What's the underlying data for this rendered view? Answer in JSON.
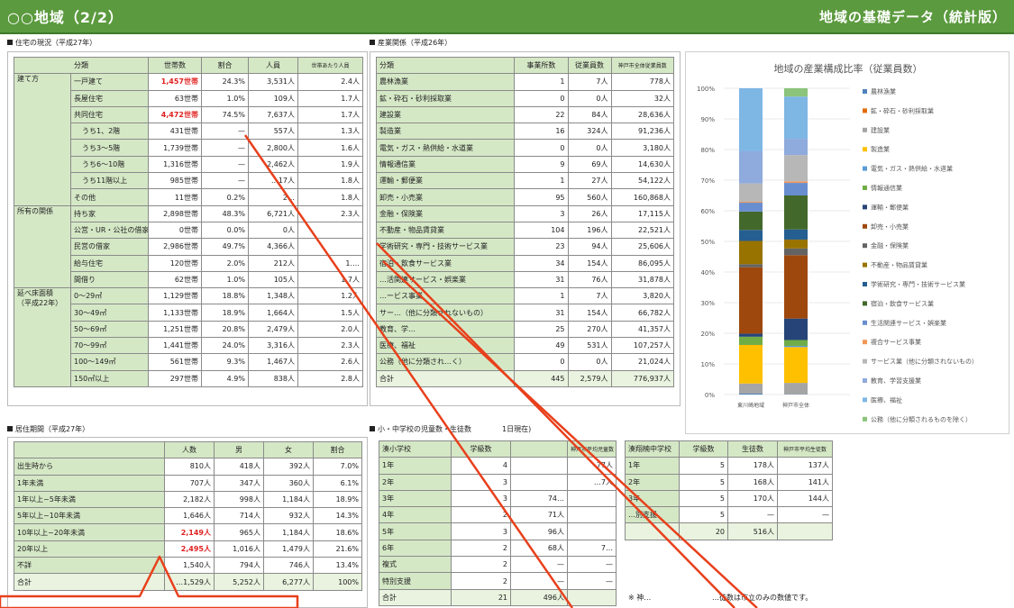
{
  "header": {
    "title": "○○地域（2/2）",
    "subtitle": "地域の基礎データ（統計版）"
  },
  "housing": {
    "label": "住宅の現況（平成27年）",
    "columns": [
      "分類",
      "世帯数",
      "割合",
      "人員",
      "世帯あたり人員"
    ],
    "groups": [
      {
        "category": "建て方",
        "rows": [
          {
            "sub": "一戸建て",
            "households": "1,457世帯",
            "ratio": "24.3%",
            "people": "3,531人",
            "per": "2.4人",
            "red": true
          },
          {
            "sub": "長屋住宅",
            "households": "63世帯",
            "ratio": "1.0%",
            "people": "109人",
            "per": "1.7人"
          },
          {
            "sub": "共同住宅",
            "households": "4,472世帯",
            "ratio": "74.5%",
            "people": "7,637人",
            "per": "1.7人",
            "red": true
          },
          {
            "sub": "うち1、2階",
            "households": "431世帯",
            "ratio": "—",
            "people": "557人",
            "per": "1.3人",
            "indent": true
          },
          {
            "sub": "うち3～5階",
            "households": "1,739世帯",
            "ratio": "—",
            "people": "2,800人",
            "per": "1.6人",
            "indent": true
          },
          {
            "sub": "うち6～10階",
            "households": "1,316世帯",
            "ratio": "—",
            "people": "2,462人",
            "per": "1.9人",
            "indent": true
          },
          {
            "sub": "うち11階以上",
            "households": "985世帯",
            "ratio": "—",
            "people": "…17人",
            "per": "1.8人",
            "indent": true
          },
          {
            "sub": "その他",
            "households": "11世帯",
            "ratio": "0.2%",
            "people": "2…",
            "per": "1.8人"
          }
        ]
      },
      {
        "category": "所有の関係",
        "rows": [
          {
            "sub": "持ち家",
            "households": "2,898世帯",
            "ratio": "48.3%",
            "people": "6,721人",
            "per": "2.3人"
          },
          {
            "sub": "公営・UR・公社の借家",
            "households": "0世帯",
            "ratio": "0.0%",
            "people": "0人",
            "per": ""
          },
          {
            "sub": "民営の借家",
            "households": "2,986世帯",
            "ratio": "49.7%",
            "people": "4,366人",
            "per": ""
          },
          {
            "sub": "給与住宅",
            "households": "120世帯",
            "ratio": "2.0%",
            "people": "212人",
            "per": "1.…"
          },
          {
            "sub": "間借り",
            "households": "62世帯",
            "ratio": "1.0%",
            "people": "105人",
            "per": "1.7人"
          }
        ]
      },
      {
        "category": "延べ床面積\n（平成22年）",
        "rows": [
          {
            "sub": "0～29㎡",
            "households": "1,129世帯",
            "ratio": "18.8%",
            "people": "1,348人",
            "per": "1.2人"
          },
          {
            "sub": "30～49㎡",
            "households": "1,133世帯",
            "ratio": "18.9%",
            "people": "1,664人",
            "per": "1.5人"
          },
          {
            "sub": "50～69㎡",
            "households": "1,251世帯",
            "ratio": "20.8%",
            "people": "2,479人",
            "per": "2.0人"
          },
          {
            "sub": "70～99㎡",
            "households": "1,441世帯",
            "ratio": "24.0%",
            "people": "3,316人",
            "per": "2.3人"
          },
          {
            "sub": "100～149㎡",
            "households": "561世帯",
            "ratio": "9.3%",
            "people": "1,467人",
            "per": "2.6人"
          },
          {
            "sub": "150㎡以上",
            "households": "297世帯",
            "ratio": "4.9%",
            "people": "838人",
            "per": "2.8人"
          }
        ]
      }
    ]
  },
  "industry": {
    "label": "産業関係（平成26年）",
    "columns": [
      "分類",
      "事業所数",
      "従業員数",
      "神戸市全体従業員数"
    ],
    "rows": [
      [
        "農林漁業",
        "1",
        "7人",
        "778人"
      ],
      [
        "鉱・砕石・砂利採取業",
        "0",
        "0人",
        "32人"
      ],
      [
        "建設業",
        "22",
        "84人",
        "28,636人"
      ],
      [
        "製造業",
        "16",
        "324人",
        "91,236人"
      ],
      [
        "電気・ガス・熱供給・水道業",
        "0",
        "0人",
        "3,180人"
      ],
      [
        "情報通信業",
        "9",
        "69人",
        "14,630人"
      ],
      [
        "運輸・郵便業",
        "1",
        "27人",
        "54,122人"
      ],
      [
        "卸売・小売業",
        "95",
        "560人",
        "160,868人"
      ],
      [
        "金融・保険業",
        "3",
        "26人",
        "17,115人"
      ],
      [
        "不動産・物品賃貸業",
        "104",
        "196人",
        "22,521人"
      ],
      [
        "学術研究・専門・技術サービス業",
        "23",
        "94人",
        "25,606人"
      ],
      [
        "宿泊・飲食サービス業",
        "34",
        "154人",
        "86,095人"
      ],
      [
        "…活関連サービス・娯楽業",
        "31",
        "76人",
        "31,878人"
      ],
      [
        "…ービス事業",
        "1",
        "7人",
        "3,820人"
      ],
      [
        "サー…（他に分類されないもの）",
        "31",
        "154人",
        "66,782人"
      ],
      [
        "教育、学…",
        "25",
        "270人",
        "41,357人"
      ],
      [
        "医療、福祉",
        "49",
        "531人",
        "107,257人"
      ],
      [
        "公務（他に分類され…く）",
        "0",
        "0人",
        "21,024人"
      ]
    ],
    "total": [
      "合計",
      "445",
      "2,579人",
      "776,937人"
    ]
  },
  "chart_data": {
    "type": "bar",
    "stacked": true,
    "title": "地域の産業構成比率（従業員数）",
    "categories": [
      "東川崎地域",
      "神戸市全体"
    ],
    "ylim": [
      0,
      100
    ],
    "yticks": [
      "0%",
      "10%",
      "20%",
      "30%",
      "40%",
      "50%",
      "60%",
      "70%",
      "80%",
      "90%",
      "100%"
    ],
    "legend_position": "right",
    "series": [
      {
        "name": "農林漁業",
        "color": "#4f81bd",
        "values": [
          0.3,
          0.1
        ]
      },
      {
        "name": "鉱・砕石・砂利採取業",
        "color": "#e36c09",
        "values": [
          0.0,
          0.0
        ]
      },
      {
        "name": "建設業",
        "color": "#a5a5a5",
        "values": [
          3.3,
          3.7
        ]
      },
      {
        "name": "製造業",
        "color": "#ffc000",
        "values": [
          12.6,
          11.7
        ]
      },
      {
        "name": "電気・ガス・熱供給・水道業",
        "color": "#5b9bd5",
        "values": [
          0.0,
          0.4
        ]
      },
      {
        "name": "情報通信業",
        "color": "#70ad47",
        "values": [
          2.7,
          1.9
        ]
      },
      {
        "name": "運輸・郵便業",
        "color": "#264478",
        "values": [
          1.0,
          7.0
        ]
      },
      {
        "name": "卸売・小売業",
        "color": "#9e480e",
        "values": [
          21.7,
          20.7
        ]
      },
      {
        "name": "金融・保険業",
        "color": "#636363",
        "values": [
          1.0,
          2.2
        ]
      },
      {
        "name": "不動産・物品賃貸業",
        "color": "#997300",
        "values": [
          7.6,
          2.9
        ]
      },
      {
        "name": "学術研究・専門・技術サービス業",
        "color": "#255e91",
        "values": [
          3.6,
          3.3
        ]
      },
      {
        "name": "宿泊・飲食サービス業",
        "color": "#43682b",
        "values": [
          6.0,
          11.1
        ]
      },
      {
        "name": "生活関連サービス・娯楽業",
        "color": "#698ed0",
        "values": [
          2.9,
          4.1
        ]
      },
      {
        "name": "複合サービス事業",
        "color": "#f1975a",
        "values": [
          0.3,
          0.5
        ]
      },
      {
        "name": "サービス業（他に分類されないもの）",
        "color": "#b7b7b7",
        "values": [
          6.0,
          8.6
        ]
      },
      {
        "name": "教育、学習支援業",
        "color": "#8faadc",
        "values": [
          10.5,
          5.3
        ]
      },
      {
        "name": "医療、福祉",
        "color": "#7eb6e4",
        "values": [
          20.6,
          13.8
        ]
      },
      {
        "name": "公務（他に分類されるものを除く）",
        "color": "#8bc47a",
        "values": [
          0.0,
          2.7
        ]
      }
    ]
  },
  "residence": {
    "label": "居住期間（平成27年）",
    "columns": [
      "",
      "人数",
      "男",
      "女",
      "割合"
    ],
    "rows": [
      {
        "cells": [
          "出生時から",
          "810人",
          "418人",
          "392人",
          "7.0%"
        ]
      },
      {
        "cells": [
          "1年未満",
          "707人",
          "347人",
          "360人",
          "6.1%"
        ]
      },
      {
        "cells": [
          "1年以上~5年未満",
          "2,182人",
          "998人",
          "1,184人",
          "18.9%"
        ]
      },
      {
        "cells": [
          "5年以上~10年未満",
          "1,646人",
          "714人",
          "932人",
          "14.3%"
        ]
      },
      {
        "cells": [
          "10年以上~20年未満",
          "2,149人",
          "965人",
          "1,184人",
          "18.6%"
        ],
        "red": true
      },
      {
        "cells": [
          "20年以上",
          "2,495人",
          "1,016人",
          "1,479人",
          "21.6%"
        ],
        "red": true
      },
      {
        "cells": [
          "不詳",
          "1,540人",
          "794人",
          "746人",
          "13.4%"
        ]
      },
      {
        "cells": [
          "合計",
          "…1,529人",
          "5,252人",
          "6,277人",
          "100%"
        ],
        "total": true
      }
    ]
  },
  "school": {
    "label": "小・中学校の児童数・生徒数",
    "label_tail": "1日現在)",
    "elementary": {
      "columns": [
        "湊小学校",
        "学級数",
        "",
        "神戸市平均児童数"
      ],
      "rows": [
        [
          "1年",
          "4",
          "",
          "77人"
        ],
        [
          "2年",
          "3",
          "",
          "…7人"
        ],
        [
          "3年",
          "3",
          "74…",
          ""
        ],
        [
          "4年",
          "2",
          "71人",
          ""
        ],
        [
          "5年",
          "3",
          "96人",
          ""
        ],
        [
          "6年",
          "2",
          "68人",
          "7…"
        ],
        [
          "複式",
          "2",
          "—",
          "—"
        ],
        [
          "特別支援",
          "2",
          "—",
          "—"
        ]
      ],
      "total": [
        "合計",
        "21",
        "496人",
        ""
      ]
    },
    "junior": {
      "columns": [
        "湊翔楠中学校",
        "学級数",
        "生徒数",
        "神戸市平均生徒数"
      ],
      "rows": [
        [
          "1年",
          "5",
          "178人",
          "137人"
        ],
        [
          "2年",
          "5",
          "168人",
          "141人"
        ],
        [
          "3年",
          "5",
          "170人",
          "144人"
        ],
        [
          "…別支援",
          "5",
          "—",
          "—"
        ]
      ],
      "total": [
        "",
        "20",
        "516人",
        ""
      ]
    },
    "note_left": "※ 神…",
    "note_right": "…徒数は市立のみの数値です。"
  },
  "annotation": {
    "color": "#e8401c"
  }
}
